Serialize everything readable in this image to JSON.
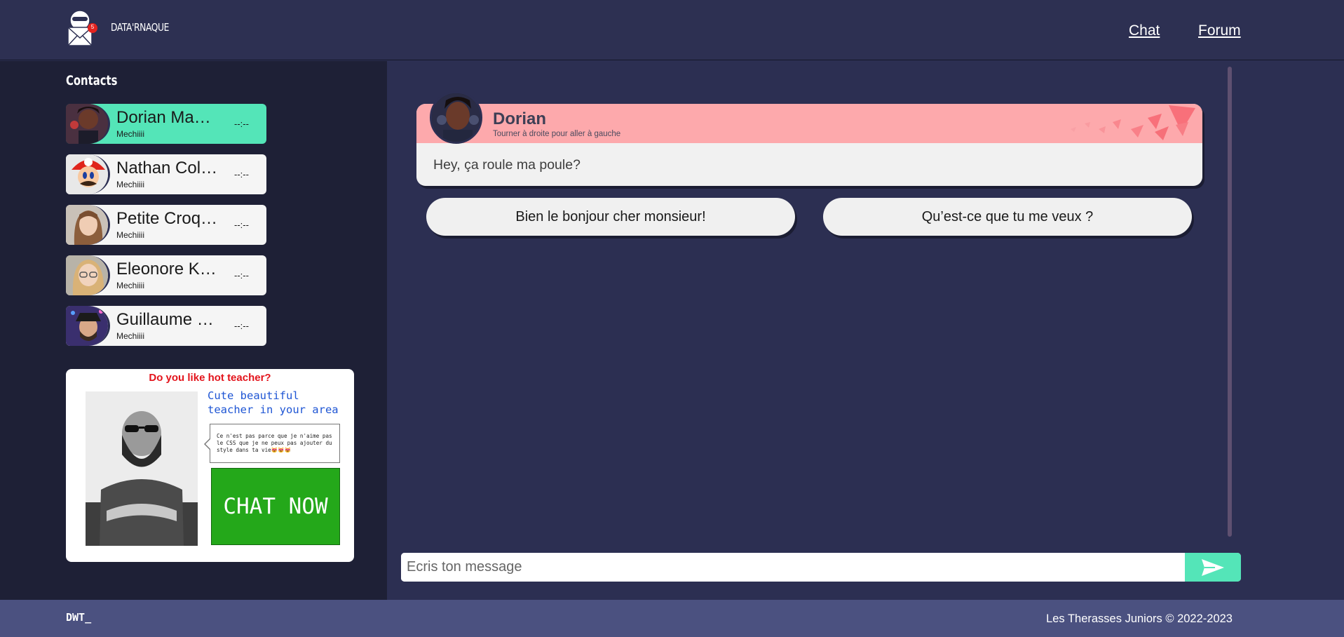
{
  "header": {
    "brand": "DATA'RNAQUE",
    "notification_count": "5",
    "nav": [
      {
        "label": "Chat"
      },
      {
        "label": "Forum"
      }
    ]
  },
  "sidebar": {
    "title": "Contacts",
    "contacts": [
      {
        "name": "Dorian Ma…",
        "subtitle": "Mechiiii",
        "time": "--:--",
        "active": true
      },
      {
        "name": "Nathan Col…",
        "subtitle": "Mechiiii",
        "time": "--:--"
      },
      {
        "name": "Petite Croq…",
        "subtitle": "Mechiiii",
        "time": "--:--"
      },
      {
        "name": "Eleonore K…",
        "subtitle": "Mechiiii",
        "time": "--:--"
      },
      {
        "name": "Guillaume …",
        "subtitle": "Mechiiii",
        "time": "--:--"
      }
    ]
  },
  "ad": {
    "title": "Do you like hot teacher?",
    "tagline": "Cute beautiful teacher in your area",
    "bubble": "Ce n'est pas parce que je n'aime pas le CSS que je ne peux pas ajouter du style dans ta vie😻😻😻",
    "cta": "CHAT NOW"
  },
  "chat": {
    "contact_name": "Dorian",
    "hint": "Tourner à droite pour aller à gauche",
    "message": "Hey, ça roule ma poule?",
    "replies": [
      {
        "label": "Bien le bonjour cher monsieur!"
      },
      {
        "label": "Qu’est-ce que tu me veux ?"
      }
    ],
    "composer_placeholder": "Ecris ton message"
  },
  "footer": {
    "left": "DWT_",
    "right": "Les Therasses Juniors © 2022-2023"
  },
  "colors": {
    "accent": "#54e5b8",
    "header_bg": "#2d3052",
    "sidebar_bg": "#1e2036",
    "main_bg": "#2c2f52",
    "message_header": "#fda9ac",
    "footer_bg": "#4b5180",
    "ad_cta": "#24a81a"
  }
}
